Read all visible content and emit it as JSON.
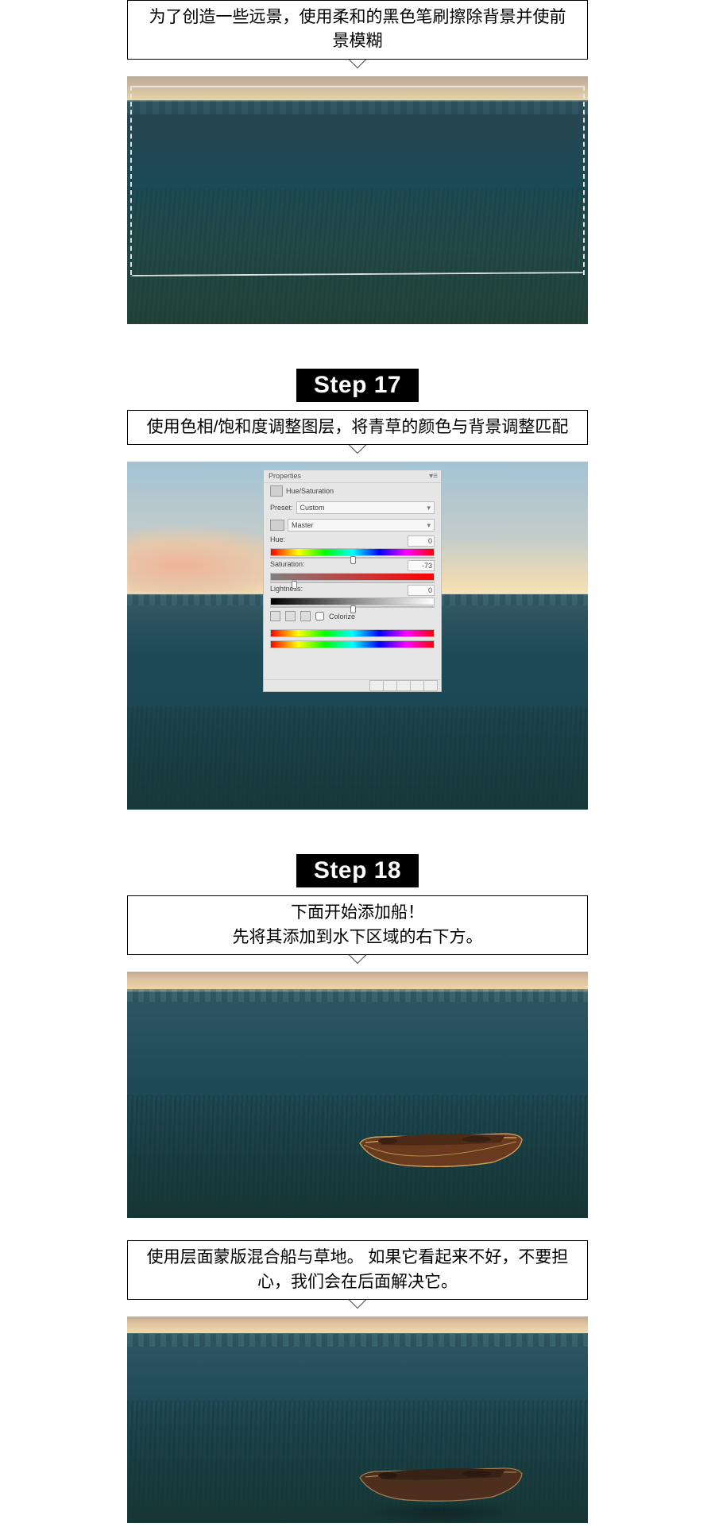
{
  "captions": {
    "c1": "为了创造一些远景，使用柔和的黑色笔刷擦除背景并使前景模糊",
    "c2": "使用色相/饱和度调整图层，将青草的颜色与背景调整匹配",
    "c3a": "下面开始添加船！",
    "c3b": "先将其添加到水下区域的右下方。",
    "c4": "使用层面蒙版混合船与草地。 如果它看起来不好，不要担心，我们会在后面解决它。"
  },
  "steps": {
    "s17": "Step 17",
    "s18": "Step 18"
  },
  "panel": {
    "tab": "Properties",
    "title": "Hue/Saturation",
    "preset_label": "Preset:",
    "preset_value": "Custom",
    "channel": "Master",
    "hue_label": "Hue:",
    "hue_value": "0",
    "sat_label": "Saturation:",
    "sat_value": "-73",
    "light_label": "Lightness:",
    "light_value": "0",
    "colorize": "Colorize"
  }
}
